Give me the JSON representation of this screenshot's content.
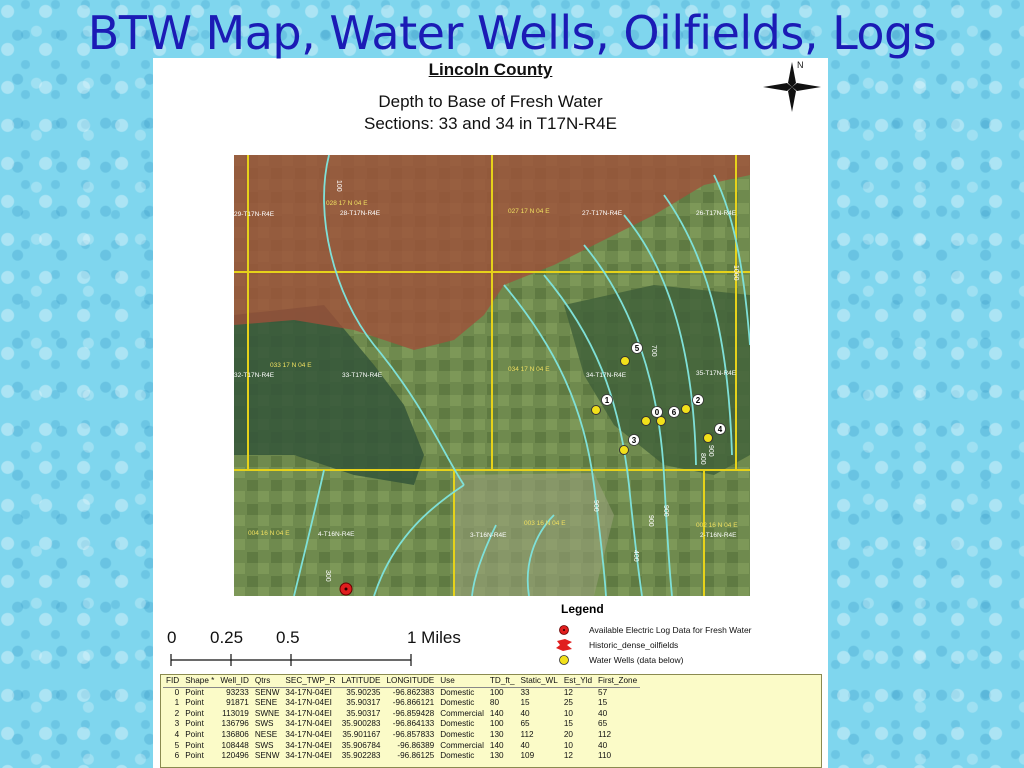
{
  "slide": {
    "title": "BTW Map, Water Wells, Oilfields, Logs"
  },
  "map_header": {
    "county": "Lincoln County",
    "subtitle_1": "Depth to Base of Fresh Water",
    "subtitle_2": "Sections: 33 and 34 in T17N-R4E"
  },
  "compass": {
    "north_label": "N"
  },
  "map": {
    "section_labels": [
      "028 17 N 04 E",
      "28-T17N-R4E",
      "29-T17N-R4E",
      "027 17 N 04 E",
      "27-T17N-R4E",
      "26-T17N-R4E",
      "033 17 N 04 E",
      "32-T17N-R4E",
      "33-T17N-R4E",
      "034 17 N 04 E",
      "34-T17N-R4E",
      "35-T17N-R4E",
      "004 16 N 04 E",
      "4-T16N-R4E",
      "003 16 N 04 E",
      "3-T16N-R4E",
      "002 16 N 04 E",
      "2-T16N-R4E"
    ],
    "contour_labels": [
      "100",
      "1000",
      "700",
      "900",
      "800",
      "900",
      "900",
      "400",
      "300",
      "900"
    ],
    "well_labels": [
      "5",
      "1",
      "0",
      "6",
      "2",
      "3",
      "4"
    ]
  },
  "scale_bar": {
    "ticks": [
      "0",
      "0.25",
      "0.5",
      "1 Miles"
    ]
  },
  "legend": {
    "title": "Legend",
    "items": [
      {
        "label": "Available Electric Log Data for Fresh Water",
        "color": "#e01e1e"
      },
      {
        "label": "Historic_dense_oilfields",
        "color": "#e01e1e"
      },
      {
        "label": "Water Wells (data below)",
        "color": "#f2e01a"
      }
    ]
  },
  "table": {
    "columns": [
      "FID",
      "Shape *",
      "Well_ID",
      "Qtrs",
      "SEC_TWP_R",
      "LATITUDE",
      "LONGITUDE",
      "Use",
      "TD_ft_",
      "Static_WL",
      "Est_Yld",
      "First_Zone"
    ],
    "rows": [
      [
        "0",
        "Point",
        "93233",
        "SENW",
        "34-17N-04EI",
        "35.90235",
        "-96.862383",
        "Domestic",
        "100",
        "33",
        "12",
        "57"
      ],
      [
        "1",
        "Point",
        "91871",
        "SENE",
        "34-17N-04EI",
        "35.90317",
        "-96.866121",
        "Domestic",
        "80",
        "15",
        "25",
        "15"
      ],
      [
        "2",
        "Point",
        "113019",
        "SWNE",
        "34-17N-04EI",
        "35.90317",
        "-96.859428",
        "Commercial",
        "140",
        "40",
        "10",
        "40"
      ],
      [
        "3",
        "Point",
        "136796",
        "SWS",
        "34-17N-04EI",
        "35.900283",
        "-96.864133",
        "Domestic",
        "100",
        "65",
        "15",
        "65"
      ],
      [
        "4",
        "Point",
        "136806",
        "NESE",
        "34-17N-04EI",
        "35.901167",
        "-96.857833",
        "Domestic",
        "130",
        "112",
        "20",
        "112"
      ],
      [
        "5",
        "Point",
        "108448",
        "SWS",
        "34-17N-04EI",
        "35.906784",
        "-96.86389",
        "Commercial",
        "140",
        "40",
        "10",
        "40"
      ],
      [
        "6",
        "Point",
        "120496",
        "SENW",
        "34-17N-04EI",
        "35.902283",
        "-96.86125",
        "Domestic",
        "130",
        "109",
        "12",
        "110"
      ]
    ]
  },
  "colors": {
    "title": "#1b1bb5",
    "oilfield": "#a0503a",
    "contour": "#7fe0d8",
    "section_line": "#e6d21a",
    "well": "#f2e01a",
    "log_point": "#e01e1e",
    "table_bg": "#fbfbc8"
  }
}
